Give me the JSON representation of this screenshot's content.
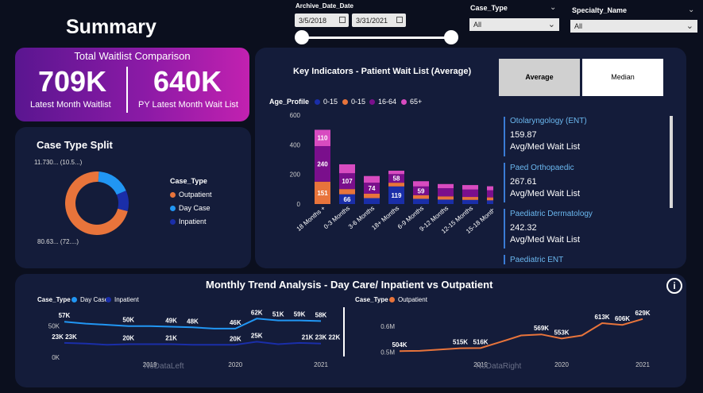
{
  "page": {
    "title": "Summary"
  },
  "filters": {
    "date": {
      "label": "Archive_Date_Date",
      "start": "3/5/2018",
      "end": "3/31/2021"
    },
    "case_type": {
      "label": "Case_Type",
      "value": "All"
    },
    "specialty": {
      "label": "Specialty_Name",
      "value": "All"
    }
  },
  "kpi": {
    "title": "Total Waitlist Comparison",
    "latest_value": "709K",
    "latest_label": "Latest Month Waitlist",
    "py_value": "640K",
    "py_label": "PY Latest Month Wait List"
  },
  "case_split": {
    "title": "Case Type Split",
    "legend_title": "Case_Type",
    "legend": [
      {
        "label": "Outpatient",
        "color": "#e8743b"
      },
      {
        "label": "Day Case",
        "color": "#2196f3"
      },
      {
        "label": "Inpatient",
        "color": "#1a2ea8"
      }
    ],
    "label_top": "11.730... (10.5...)",
    "label_bottom": "80.63... (72....)"
  },
  "key_indicators": {
    "title": "Key Indicators - Patient Wait List (Average)",
    "toggle_average": "Average",
    "toggle_median": "Median",
    "legend_title": "Age_Profile",
    "legend": [
      {
        "label": "0-15",
        "color": "#1a2ea8"
      },
      {
        "label": "0-15",
        "color": "#e8743b"
      },
      {
        "label": "16-64",
        "color": "#7a0f8c"
      },
      {
        "label": "65+",
        "color": "#d84bc0"
      }
    ],
    "y_ticks": [
      "600",
      "400",
      "200",
      "0"
    ],
    "specialties": [
      {
        "name": "Otolaryngology (ENT)",
        "value": "159.87",
        "sub": "Avg/Med Wait List"
      },
      {
        "name": "Paed Orthopaedic",
        "value": "267.61",
        "sub": "Avg/Med Wait List"
      },
      {
        "name": "Paediatric Dermatology",
        "value": "242.32",
        "sub": "Avg/Med Wait List"
      },
      {
        "name": "Paediatric ENT",
        "value": "",
        "sub": ""
      }
    ]
  },
  "chart_data": [
    {
      "type": "bar",
      "stacked": true,
      "title": "Key Indicators - Patient Wait List (Average)",
      "categories": [
        "18 Months +",
        "0-3 Months",
        "3-6 Months",
        "18+ Months",
        "6-9 Months",
        "9-12 Months",
        "12-15 Months",
        "15-18 Months"
      ],
      "ylim": [
        0,
        600
      ],
      "series": [
        {
          "name": "0-15",
          "color": "#1a2ea8",
          "values": [
            0,
            66,
            40,
            119,
            35,
            30,
            28,
            25
          ]
        },
        {
          "name": "0-15",
          "color": "#e8743b",
          "values": [
            151,
            35,
            30,
            25,
            25,
            22,
            20,
            20
          ]
        },
        {
          "name": "16-64",
          "color": "#7a0f8c",
          "values": [
            240,
            107,
            74,
            58,
            59,
            55,
            50,
            48
          ]
        },
        {
          "name": "65+",
          "color": "#d84bc0",
          "values": [
            110,
            60,
            45,
            23,
            35,
            28,
            30,
            27
          ]
        }
      ],
      "data_labels": [
        {
          "category": 0,
          "series": 1,
          "text": "151"
        },
        {
          "category": 0,
          "series": 2,
          "text": "240"
        },
        {
          "category": 0,
          "series": 3,
          "text": "110"
        },
        {
          "category": 1,
          "series": 0,
          "text": "66"
        },
        {
          "category": 1,
          "series": 2,
          "text": "107"
        },
        {
          "category": 2,
          "series": 2,
          "text": "74"
        },
        {
          "category": 3,
          "series": 0,
          "text": "119"
        },
        {
          "category": 3,
          "series": 2,
          "text": "58"
        },
        {
          "category": 4,
          "series": 2,
          "text": "59"
        }
      ]
    },
    {
      "type": "pie",
      "title": "Case Type Split",
      "categories": [
        "Outpatient",
        "Day Case",
        "Inpatient"
      ],
      "values": [
        72.0,
        17.5,
        10.5
      ],
      "colors": [
        "#e8743b",
        "#2196f3",
        "#1a2ea8"
      ]
    },
    {
      "type": "line",
      "legend_title": "Case_Type",
      "x": [
        "2018-03",
        "2018-06",
        "2018-09",
        "2018-12",
        "2019-03",
        "2019-06",
        "2019-09",
        "2019-12",
        "2020-03",
        "2020-06",
        "2020-09",
        "2020-12",
        "2021-03"
      ],
      "x_ticks": [
        "2019",
        "2020",
        "2021"
      ],
      "y_ticks": [
        "50K",
        "0K"
      ],
      "ylim": [
        0,
        70
      ],
      "series": [
        {
          "name": "Day Case",
          "color": "#2196f3",
          "values": [
            57,
            54,
            52,
            50,
            50,
            49,
            48,
            46,
            46,
            62,
            59,
            59,
            58
          ]
        },
        {
          "name": "Inpatient",
          "color": "#1a2ea8",
          "values": [
            23,
            22,
            20,
            21,
            21,
            21,
            20,
            20,
            20,
            25,
            21,
            23,
            22
          ]
        }
      ],
      "labels": [
        {
          "series": 0,
          "index": 0,
          "text": "57K"
        },
        {
          "series": 0,
          "index": 3,
          "text": "50K"
        },
        {
          "series": 0,
          "index": 5,
          "text": "49K"
        },
        {
          "series": 0,
          "index": 6,
          "text": "48K"
        },
        {
          "series": 0,
          "index": 8,
          "text": "46K"
        },
        {
          "series": 0,
          "index": 9,
          "text": "62K"
        },
        {
          "series": 0,
          "index": 10,
          "text": "51K"
        },
        {
          "series": 0,
          "index": 11,
          "text": "59K"
        },
        {
          "series": 0,
          "index": 12,
          "text": "58K"
        },
        {
          "series": 1,
          "index": 0,
          "text": "23K 23K"
        },
        {
          "series": 1,
          "index": 3,
          "text": "20K"
        },
        {
          "series": 1,
          "index": 5,
          "text": "21K"
        },
        {
          "series": 1,
          "index": 8,
          "text": "20K"
        },
        {
          "series": 1,
          "index": 9,
          "text": "25K"
        },
        {
          "series": 1,
          "index": 12,
          "text": "21K 23K 22K"
        }
      ],
      "watermark": "NoDataLeft"
    },
    {
      "type": "line",
      "legend_title": "Case_Type",
      "x": [
        "2018-03",
        "2018-06",
        "2018-09",
        "2018-12",
        "2019-03",
        "2019-06",
        "2019-09",
        "2019-12",
        "2020-03",
        "2020-06",
        "2020-09",
        "2020-12",
        "2021-03"
      ],
      "x_ticks": [
        "2019",
        "2020",
        "2021"
      ],
      "y_ticks": [
        "0.6M",
        "0.5M"
      ],
      "ylim": [
        0.48,
        0.65
      ],
      "series": [
        {
          "name": "Outpatient",
          "color": "#e8743b",
          "values": [
            0.504,
            0.505,
            0.51,
            0.515,
            0.516,
            0.54,
            0.565,
            0.569,
            0.553,
            0.565,
            0.613,
            0.606,
            0.629
          ]
        }
      ],
      "labels": [
        {
          "series": 0,
          "index": 0,
          "text": "504K"
        },
        {
          "series": 0,
          "index": 3,
          "text": "515K"
        },
        {
          "series": 0,
          "index": 4,
          "text": "516K"
        },
        {
          "series": 0,
          "index": 7,
          "text": "569K"
        },
        {
          "series": 0,
          "index": 8,
          "text": "553K"
        },
        {
          "series": 0,
          "index": 10,
          "text": "613K"
        },
        {
          "series": 0,
          "index": 11,
          "text": "606K"
        },
        {
          "series": 0,
          "index": 12,
          "text": "629K"
        }
      ],
      "watermark": "NoDataRight"
    }
  ],
  "trend": {
    "title": "Monthly Trend Analysis - Day Care/ Inpatient vs Outpatient",
    "left_legend_title": "Case_Type",
    "left_legend": [
      "Day Case",
      "Inpatient"
    ],
    "right_legend_title": "Case_Type",
    "right_legend": [
      "Outpatient"
    ],
    "info_icon": "i"
  }
}
